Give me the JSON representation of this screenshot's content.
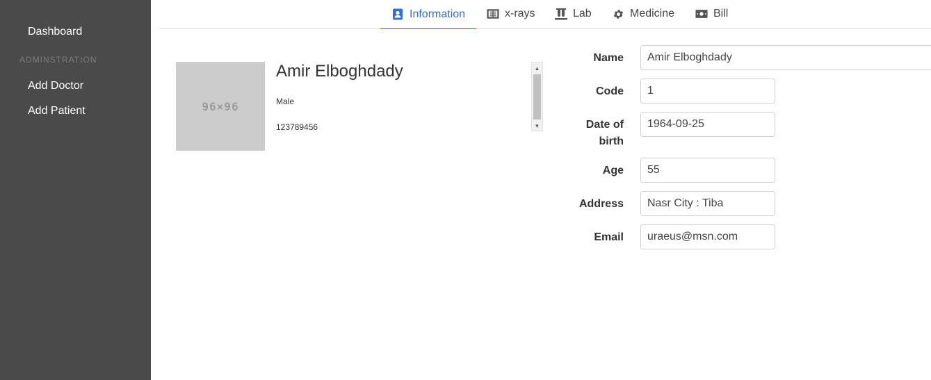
{
  "sidebar": {
    "dashboard": "Dashboard",
    "section_heading": "ADMINSTRATION",
    "items": [
      {
        "label": "Add Doctor"
      },
      {
        "label": "Add Patient"
      }
    ]
  },
  "tabs": [
    {
      "label": "Information",
      "icon": "contact-card-icon",
      "active": true
    },
    {
      "label": "x-rays",
      "icon": "xray-icon"
    },
    {
      "label": "Lab",
      "icon": "lab-icon"
    },
    {
      "label": "Medicine",
      "icon": "gear-icon"
    },
    {
      "label": "Bill",
      "icon": "money-bill-icon"
    }
  ],
  "profile": {
    "avatar_text": "96×96",
    "name": "Amir Elboghdady",
    "gender": "Male",
    "phone": "123789456"
  },
  "form": {
    "name_label": "Name",
    "name_value": "Amir Elboghdady",
    "code_label": "Code",
    "code_value": "1",
    "dob_label_line1": "Date of",
    "dob_label_line2": "birth",
    "dob_value": "1964-09-25",
    "age_label": "Age",
    "age_value": "55",
    "address_label": "Address",
    "address_value": "Nasr City : Tiba",
    "email_label": "Email",
    "email_value": "uraeus@msn.com"
  },
  "colors": {
    "sidebar_bg": "#4a4a4a",
    "accent": "#2f6fdb"
  }
}
